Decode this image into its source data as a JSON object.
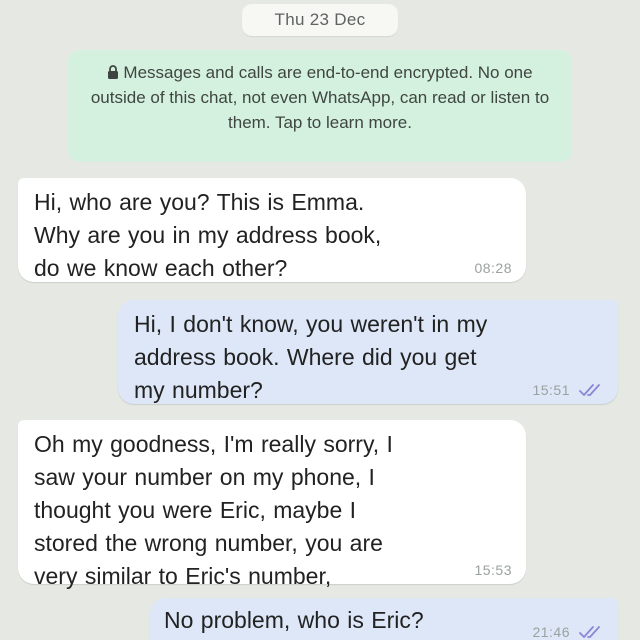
{
  "chat": {
    "date": "Thu 23 Dec",
    "encryption_notice": "Messages and calls are end-to-end encrypted. No one outside of this chat, not even WhatsApp, can read or listen to them. Tap to learn more.",
    "messages": [
      {
        "direction": "incoming",
        "lines": [
          "Hi, who are you? This is Emma.",
          "Why are you in my address book,",
          "do we know each other?"
        ],
        "time": "08:28"
      },
      {
        "direction": "outgoing",
        "lines": [
          "Hi, I don't know, you weren't in my",
          "address book. Where did you get",
          "my number?"
        ],
        "time": "15:51",
        "status_icon": "double-check-read-icon"
      },
      {
        "direction": "incoming",
        "lines": [
          "Oh my goodness, I'm really sorry, I",
          "saw your number on my phone, I",
          "thought you were Eric, maybe I",
          "stored the wrong number, you are",
          "very similar to Eric's number,"
        ],
        "time": "15:53"
      },
      {
        "direction": "outgoing",
        "lines": [
          "No problem, who is Eric?"
        ],
        "time": "21:46",
        "status_icon": "double-check-read-icon"
      }
    ]
  },
  "colors": {
    "background": "#e6e9e3",
    "incoming_bubble": "#ffffff",
    "outgoing_bubble": "#dde7f7",
    "notice_bubble": "#d4f1df",
    "read_ticks": "#8b86d6"
  }
}
